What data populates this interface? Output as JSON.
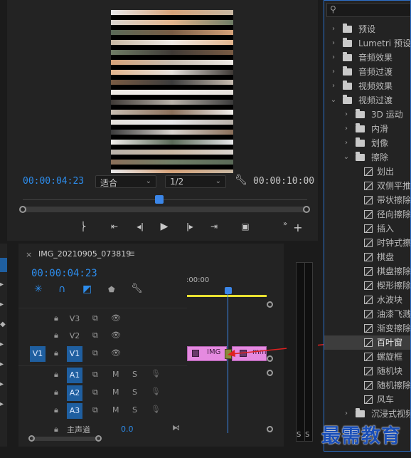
{
  "program_monitor": {
    "playhead_timecode": "00:00:04:23",
    "duration_timecode": "00:00:10:00",
    "fit_label": "适合",
    "resolution_label": "1/2",
    "playhead_position": 0.479
  },
  "timeline": {
    "sequence_name": "IMG_20210905_073819",
    "playhead_timecode": "00:00:04:23",
    "ruler_start": ":00:00",
    "video_tracks": [
      {
        "name": "V3",
        "source": ""
      },
      {
        "name": "V2",
        "source": ""
      },
      {
        "name": "V1",
        "source": "V1"
      }
    ],
    "audio_tracks": [
      {
        "name": "A1",
        "mute": "M",
        "solo": "S"
      },
      {
        "name": "A2",
        "mute": "M",
        "solo": "S"
      },
      {
        "name": "A3",
        "mute": "M",
        "solo": "S"
      }
    ],
    "master": {
      "label": "主声道",
      "value": "0.0"
    },
    "clips": [
      {
        "label": "IMG"
      },
      {
        "label": "mm"
      }
    ]
  },
  "audio_meter": {
    "solo_left": "S",
    "solo_right": "S"
  },
  "effects_panel": {
    "items": [
      {
        "label": "预设",
        "indent": 0,
        "expanded": false,
        "kind": "folder-star"
      },
      {
        "label": "Lumetri 预设",
        "indent": 0,
        "expanded": false,
        "kind": "folder-star"
      },
      {
        "label": "音频效果",
        "indent": 0,
        "expanded": false,
        "kind": "folder"
      },
      {
        "label": "音频过渡",
        "indent": 0,
        "expanded": false,
        "kind": "folder"
      },
      {
        "label": "视频效果",
        "indent": 0,
        "expanded": false,
        "kind": "folder"
      },
      {
        "label": "视频过渡",
        "indent": 0,
        "expanded": true,
        "kind": "folder"
      },
      {
        "label": "3D 运动",
        "indent": 1,
        "expanded": false,
        "kind": "folder"
      },
      {
        "label": "内滑",
        "indent": 1,
        "expanded": false,
        "kind": "folder"
      },
      {
        "label": "划像",
        "indent": 1,
        "expanded": false,
        "kind": "folder"
      },
      {
        "label": "擦除",
        "indent": 1,
        "expanded": true,
        "kind": "folder"
      },
      {
        "label": "划出",
        "indent": 2,
        "kind": "effect"
      },
      {
        "label": "双侧平推",
        "indent": 2,
        "kind": "effect"
      },
      {
        "label": "带状擦除",
        "indent": 2,
        "kind": "effect"
      },
      {
        "label": "径向擦除",
        "indent": 2,
        "kind": "effect"
      },
      {
        "label": "插入",
        "indent": 2,
        "kind": "effect"
      },
      {
        "label": "时钟式擦",
        "indent": 2,
        "kind": "effect"
      },
      {
        "label": "棋盘",
        "indent": 2,
        "kind": "effect"
      },
      {
        "label": "棋盘擦除",
        "indent": 2,
        "kind": "effect"
      },
      {
        "label": "楔形擦除",
        "indent": 2,
        "kind": "effect"
      },
      {
        "label": "水波块",
        "indent": 2,
        "kind": "effect"
      },
      {
        "label": "油漆飞溅",
        "indent": 2,
        "kind": "effect"
      },
      {
        "label": "渐变擦除",
        "indent": 2,
        "kind": "effect"
      },
      {
        "label": "百叶窗",
        "indent": 2,
        "kind": "effect",
        "selected": true
      },
      {
        "label": "螺旋框",
        "indent": 2,
        "kind": "effect"
      },
      {
        "label": "随机块",
        "indent": 2,
        "kind": "effect"
      },
      {
        "label": "随机擦除",
        "indent": 2,
        "kind": "effect"
      },
      {
        "label": "风车",
        "indent": 2,
        "kind": "effect"
      },
      {
        "label": "沉浸式视频",
        "indent": 1,
        "expanded": false,
        "kind": "folder"
      }
    ]
  },
  "watermark": {
    "text": "最需教育"
  },
  "colors": {
    "accent_blue": "#2d8ceb",
    "playhead_blue": "#3b86e8",
    "clip_pink": "#e58ae0",
    "track_target_blue": "#1f5fa0",
    "work_area_yellow": "#e8e030",
    "annotation_red": "#e02020"
  }
}
